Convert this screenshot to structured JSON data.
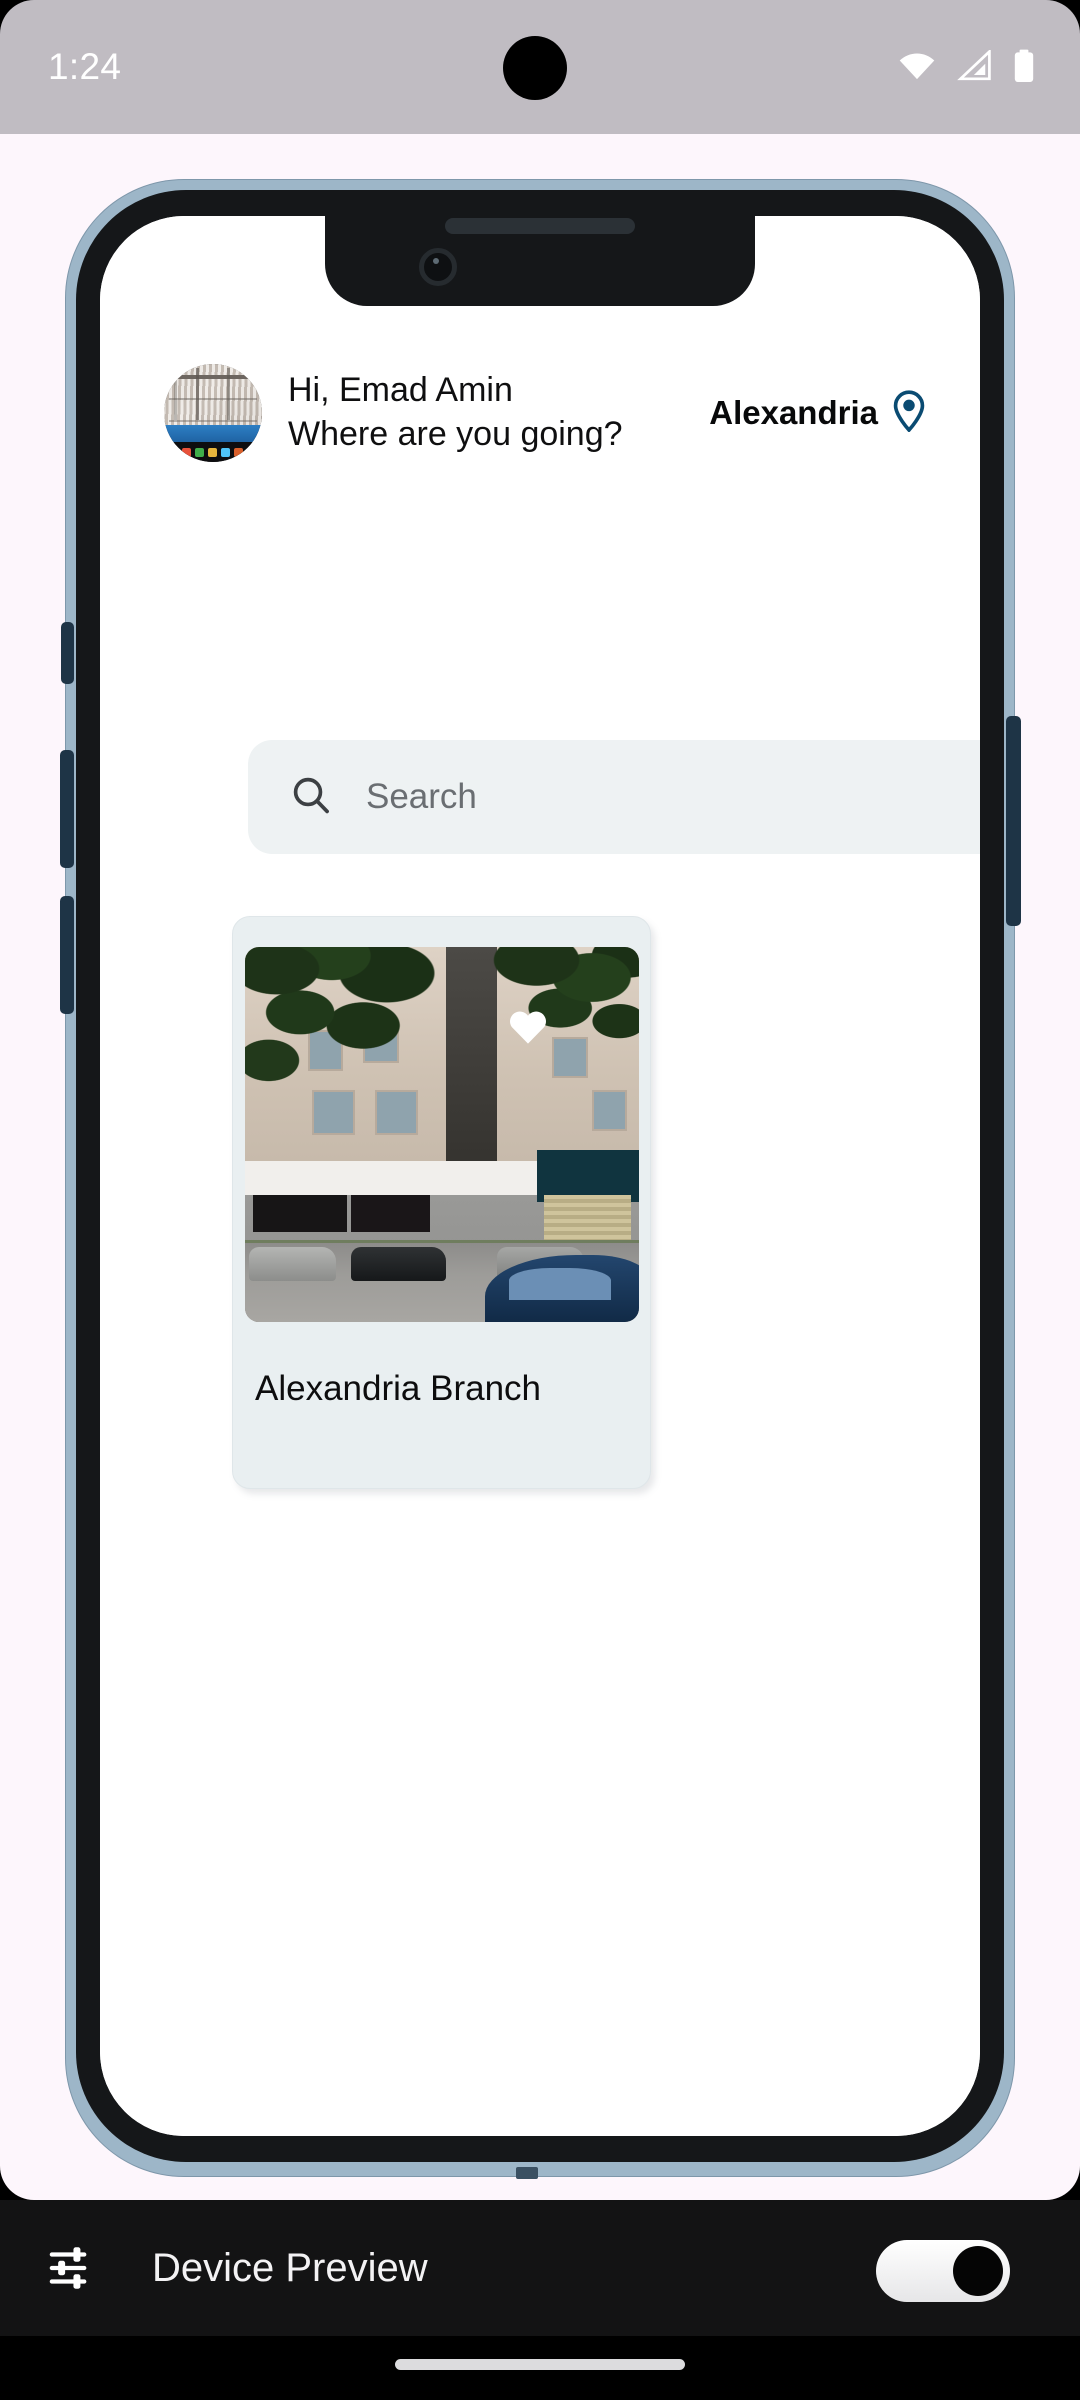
{
  "status_bar": {
    "time": "1:24",
    "icons": [
      {
        "name": "wifi-icon",
        "label": "wifi"
      },
      {
        "name": "cellular-signal-icon",
        "label": "signal"
      },
      {
        "name": "battery-icon",
        "label": "battery"
      }
    ]
  },
  "app": {
    "header": {
      "avatar_alt": "user-avatar",
      "greeting": "Hi, Emad Amin",
      "subtitle": "Where are you going?",
      "city": "Alexandria",
      "location_icon": "location-pin-icon"
    },
    "search": {
      "icon": "search-icon",
      "placeholder": "Search",
      "value": ""
    },
    "cards": [
      {
        "title": "Alexandria Branch",
        "favorite_icon": "heart-icon",
        "favorited": true,
        "photo_alt": "alexandria-branch-storefront"
      }
    ]
  },
  "preview_bar": {
    "icon": "tune-sliders-icon",
    "label": "Device Preview",
    "toggle_on": true
  },
  "colors": {
    "page_background": "#fdf6fc",
    "status_bar": "#c0bcc2",
    "accent_navy": "#0a4b72",
    "search_field": "#eef2f3",
    "card_background": "#e9eff1",
    "preview_bar": "#131314",
    "frame_edge": "#9db6c8",
    "frame_bezel": "#151719"
  }
}
